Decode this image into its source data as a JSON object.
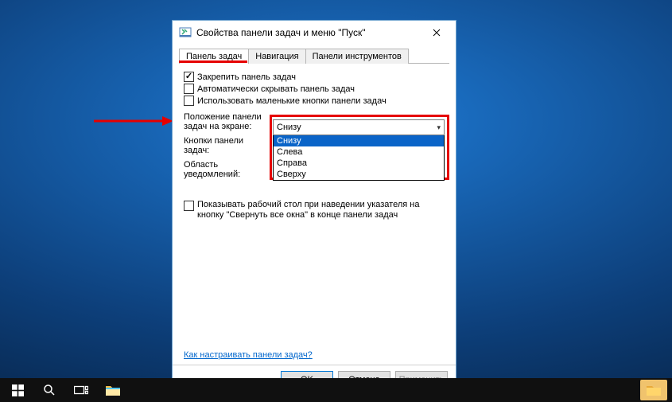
{
  "window": {
    "title": "Свойства панели задач и меню \"Пуск\""
  },
  "tabs": {
    "t0": "Панель задач",
    "t1": "Навигация",
    "t2": "Панели инструментов"
  },
  "checks": {
    "lock": "Закрепить панель задач",
    "autohide": "Автоматически скрывать панель задач",
    "smallbtn": "Использовать маленькие кнопки панели задач"
  },
  "labels": {
    "position": "Положение панели задач на экране:",
    "buttons": "Кнопки панели задач:",
    "notify": "Область уведомлений:"
  },
  "dropdown": {
    "selected": "Снизу",
    "opt0": "Снизу",
    "opt1": "Слева",
    "opt2": "Справа",
    "opt3": "Сверху"
  },
  "lower": {
    "showdesktop": "Показывать рабочий стол при наведении указателя на кнопку \"Свернуть все окна\" в конце панели задач"
  },
  "help": "Как настраивать панели задач?",
  "buttons": {
    "ok": "OK",
    "cancel": "Отмена",
    "apply": "Применить"
  }
}
